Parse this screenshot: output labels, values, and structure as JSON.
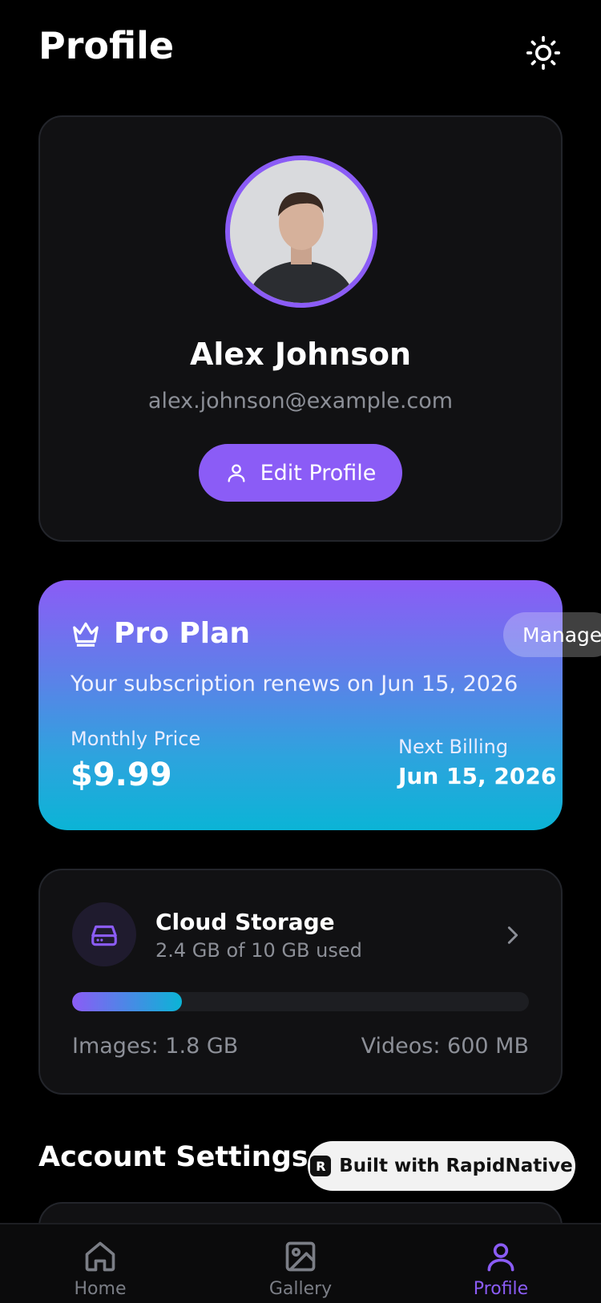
{
  "header": {
    "title": "Profile",
    "theme_icon": "sun-icon"
  },
  "profile": {
    "name": "Alex Johnson",
    "email": "alex.johnson@example.com",
    "edit_label": "Edit Profile",
    "avatar_icon": "user-photo"
  },
  "plan": {
    "title": "Pro Plan",
    "manage_label": "Manage",
    "renew_text": "Your subscription renews on Jun 15, 2026",
    "price_label": "Monthly Price",
    "price": "$9.99",
    "billing_label": "Next Billing",
    "billing_date": "Jun 15, 2026",
    "icon": "crown-icon"
  },
  "storage": {
    "title": "Cloud Storage",
    "subtitle": "2.4 GB of 10 GB used",
    "used_fraction": 0.24,
    "images": "Images: 1.8 GB",
    "videos": "Videos: 600 MB",
    "icon": "hard-drive-icon"
  },
  "settings": {
    "title": "Account Settings"
  },
  "badge": {
    "label": "Built with RapidNative",
    "logo_letter": "R"
  },
  "tabs": [
    {
      "label": "Home",
      "icon": "home-icon",
      "active": false
    },
    {
      "label": "Gallery",
      "icon": "image-icon",
      "active": false
    },
    {
      "label": "Profile",
      "icon": "user-icon",
      "active": true
    }
  ],
  "colors": {
    "accent": "#8b5cf6",
    "cyan": "#0bb4d6",
    "background": "#000000",
    "card": "#111113"
  }
}
